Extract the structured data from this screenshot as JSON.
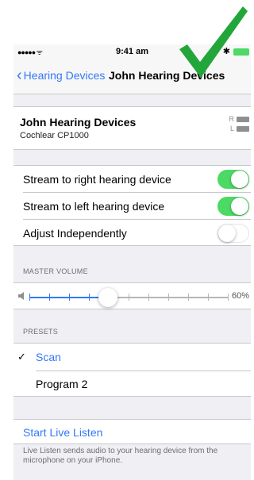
{
  "status_bar": {
    "time": "9:41 am",
    "bluetooth": "✱"
  },
  "nav": {
    "back_label": "Hearing Devices",
    "title": "John Hearing Devices"
  },
  "device": {
    "name": "John Hearing Devices",
    "model": "Cochlear CP1000",
    "batteries": [
      {
        "side": "R"
      },
      {
        "side": "L"
      }
    ]
  },
  "toggles": [
    {
      "label": "Stream to right hearing device",
      "on": true
    },
    {
      "label": "Stream to left hearing device",
      "on": true
    },
    {
      "label": "Adjust Independently",
      "on": false
    }
  ],
  "volume": {
    "header": "MASTER VOLUME",
    "percent_label": "60%",
    "level": 0.6
  },
  "presets": {
    "header": "PRESETS",
    "items": [
      {
        "label": "Scan",
        "selected": true
      },
      {
        "label": "Program 2",
        "selected": false
      }
    ],
    "checkmark": "✓"
  },
  "live_listen": {
    "link": "Start Live Listen",
    "note": "Live Listen sends audio to your hearing device from the microphone on your iPhone."
  },
  "colors": {
    "accent": "#3478f6",
    "toggle_on": "#4cd964",
    "checkmark_art": "#22a63a"
  }
}
